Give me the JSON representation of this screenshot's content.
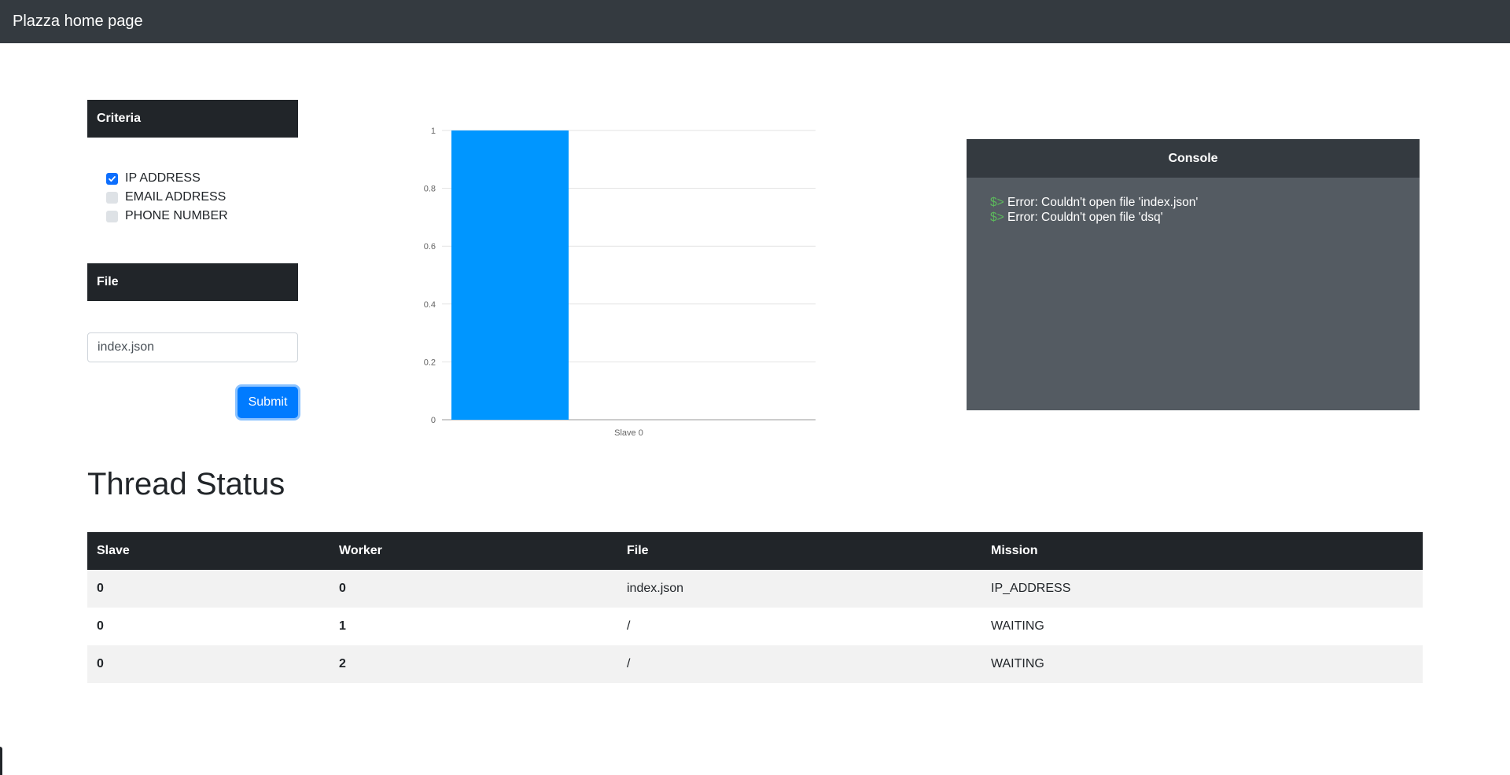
{
  "navbar": {
    "title": "Plazza home page"
  },
  "criteria": {
    "header": "Criteria",
    "options": [
      {
        "label": "IP ADDRESS",
        "checked": true
      },
      {
        "label": "EMAIL ADDRESS",
        "checked": false
      },
      {
        "label": "PHONE NUMBER",
        "checked": false
      }
    ]
  },
  "file": {
    "header": "File",
    "input_value": "index.json",
    "submit_label": "Submit"
  },
  "chart_data": {
    "type": "bar",
    "categories": [
      "Slave 0"
    ],
    "values": [
      1
    ],
    "title": "",
    "xlabel": "",
    "ylabel": "",
    "ylim": [
      0,
      1
    ],
    "yticks": [
      "0",
      "0.2",
      "0.4",
      "0.6",
      "0.8",
      "1"
    ],
    "grid": true,
    "bar_color": "#0096ff"
  },
  "console": {
    "header": "Console",
    "prompt": "$>",
    "lines": [
      "Error: Couldn't open file 'index.json'",
      "Error: Couldn't open file 'dsq'"
    ],
    "prompt_color": "#5cb85c"
  },
  "thread_status": {
    "title": "Thread Status",
    "columns": [
      "Slave",
      "Worker",
      "File",
      "Mission"
    ],
    "rows": [
      [
        "0",
        "0",
        "index.json",
        "IP_ADDRESS"
      ],
      [
        "0",
        "1",
        "/",
        "WAITING"
      ],
      [
        "0",
        "2",
        "/",
        "WAITING"
      ]
    ]
  }
}
